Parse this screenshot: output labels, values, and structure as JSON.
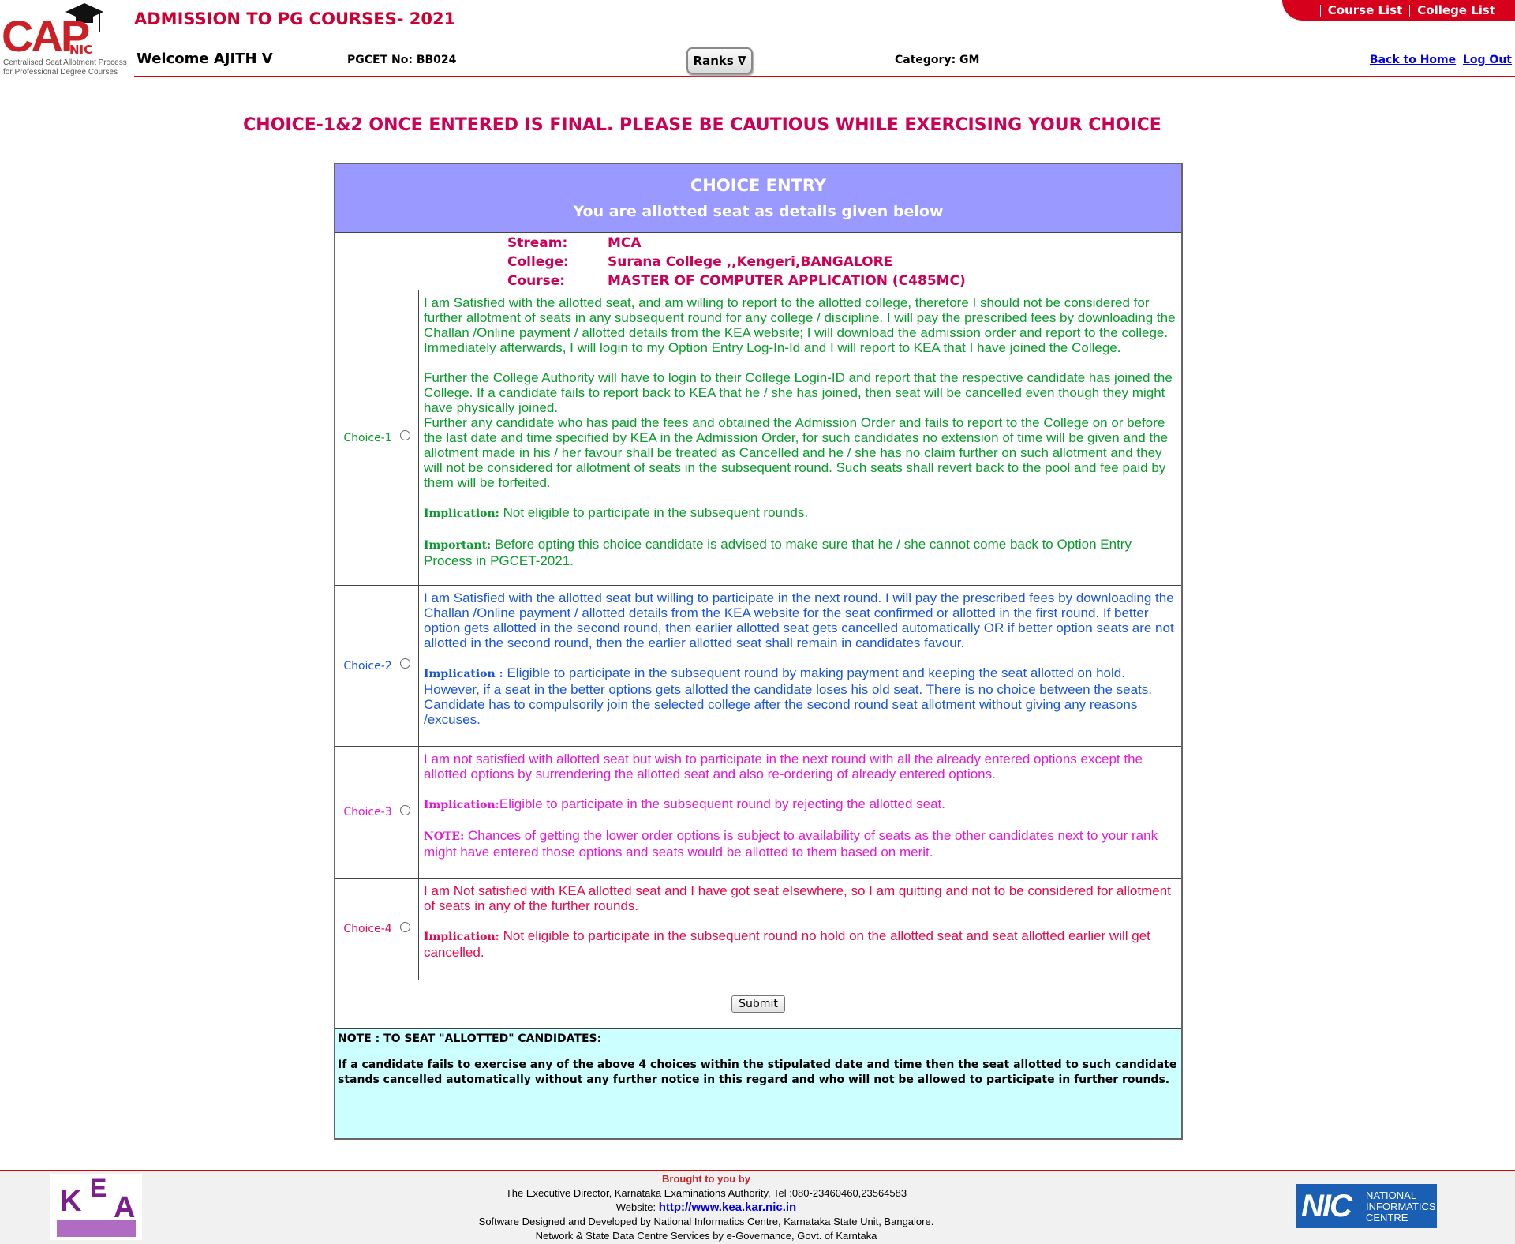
{
  "header": {
    "logo_main": "CAP",
    "logo_nic": "NIC",
    "logo_subtitle_1": "Centralised Seat Allotment Process",
    "logo_subtitle_2": "for Professional Degree Courses",
    "title": "ADMISSION TO PG COURSES- 2021",
    "top_links": [
      "Course List",
      "College List"
    ],
    "welcome": "Welcome AJITH V",
    "pgcet": "PGCET No: BB024",
    "ranks_button": "Ranks ∇",
    "category": "Category: GM",
    "back_home": "Back to Home",
    "logout": "Log Out"
  },
  "warning": "CHOICE-1&2 ONCE ENTERED IS FINAL. PLEASE BE CAUTIOUS WHILE EXERCISING YOUR CHOICE",
  "panel": {
    "title": "CHOICE ENTRY",
    "subtitle": "You are allotted seat as details given below",
    "allotment": {
      "stream_label": "Stream:",
      "stream": "MCA",
      "college_label": "College:",
      "college": "Surana College ,,Kengeri,BANGALORE",
      "course_label": "Course:",
      "course": "MASTER OF COMPUTER APPLICATION (C485MC)"
    },
    "choices": [
      {
        "label": "Choice-1",
        "color": "#0a9a2c",
        "p1": "I am Satisfied with the allotted seat, and am willing to report to the allotted college, therefore I should not be considered for further allotment of seats in any subsequent round for any college / discipline. I will pay the prescribed fees by downloading the Challan /Online payment / allotted details from the KEA website; I will download the admission order and report to the college. Immediately afterwards, I will login to my Option Entry Log-In-Id and I will report to KEA that I have joined the College.",
        "p2": "Further the College Authority will have to login to their College Login-ID and report that the respective candidate has joined the College. If a candidate fails to report back to KEA that he / she has joined, then seat will be cancelled even though they might have physically joined.",
        "p3": "Further any candidate who has paid the fees and obtained the Admission Order and fails to report to the College on or before the last date and time specified by KEA in the Admission Order, for such candidates no extension of time will be given and the allotment made in his / her favour shall be treated as Cancelled and he / she has no claim further on such allotment and they will not be considered for allotment of seats in the subsequent round. Such seats shall revert back to the pool and fee paid by them will be forfeited.",
        "implication_label": "Implication:",
        "implication": " Not eligible to participate in the subsequent rounds.",
        "important_label": "Important:",
        "important": " Before opting this choice candidate is advised to make sure that he / she cannot come back to Option Entry Process in PGCET-2021."
      },
      {
        "label": "Choice-2",
        "color": "#1a56d6",
        "p1": "I am Satisfied with the allotted seat but willing to participate in the next round. I will pay the prescribed fees by downloading the Challan /Online payment / allotted details from the KEA website for the seat confirmed or allotted in the first round. If better option gets allotted in the second round, then earlier allotted seat gets cancelled automatically OR if better option seats are not allotted in the second round, then the earlier allotted seat shall remain in candidates favour.",
        "implication_label": "Implication :",
        "implication": " Eligible to participate in the subsequent round by making payment and keeping the seat allotted on hold. However, if a seat in the better options gets allotted the candidate loses his old seat. There is no choice between the seats. Candidate has to compulsorily join the selected college after the second round seat allotment without giving any reasons /excuses."
      },
      {
        "label": "Choice-3",
        "color": "#e21ad2",
        "p1": "I am not satisfied with allotted seat but wish to participate in the next round with all the already entered options except the allotted options by surrendering the allotted seat and also re-ordering of already entered options.",
        "implication_label": "Implication:",
        "implication": "Eligible to participate in the subsequent round by rejecting the allotted seat.",
        "note_label": "NOTE:",
        "note": " Chances of getting the lower order options is subject to availability of seats as the other candidates next to your rank might have entered those options and seats would be allotted to them based on merit."
      },
      {
        "label": "Choice-4",
        "color": "#e30a4a",
        "p1": "I am Not satisfied with KEA allotted seat and I have got seat elsewhere, so I am quitting and not to be considered for allotment of seats in any of the further rounds.",
        "implication_label": "Implication:",
        "implication": " Not eligible to participate in the subsequent round no hold on the allotted seat and seat allotted earlier will get cancelled."
      }
    ],
    "submit_label": "Submit",
    "note_title": "NOTE : TO SEAT \"ALLOTTED\" CANDIDATES:",
    "note_text": "If a candidate fails to exercise any of the above 4 choices within the stipulated date and time then the seat allotted to such candidate stands cancelled automatically without any further notice in this regard and who will not be allowed to participate in further rounds."
  },
  "footer": {
    "kea_k": "K",
    "kea_e": "E",
    "kea_a": "A",
    "brought": "Brought to you by",
    "line1": "The Executive Director, Karnataka Examinations Authority, Tel :080-23460460,23564583",
    "website_label": "Website: ",
    "website": "http://www.kea.kar.nic.in",
    "line3": "Software Designed and Developed by National Informatics Centre, Karnataka State Unit, Bangalore.",
    "line4": "Network & State Data Centre Services by e-Governance, Govt. of Karntaka",
    "nic_mark": "NIC",
    "nic_text_1": "NATIONAL",
    "nic_text_2": "INFORMATICS",
    "nic_text_3": "CENTRE"
  }
}
